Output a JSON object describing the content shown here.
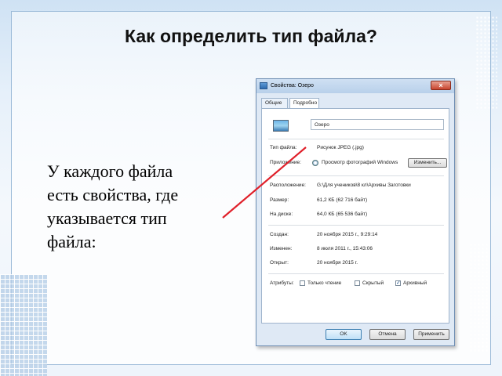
{
  "slide": {
    "title": "Как определить тип файла?",
    "body_lines": [
      "У каждого файла",
      "есть свойства, где",
      "указывается тип",
      "файла:"
    ]
  },
  "dialog": {
    "title": "Свойства: Озеро",
    "close_symbol": "×",
    "tabs": [
      {
        "label": "Общие",
        "active": true
      },
      {
        "label": "Подробно",
        "active": false
      }
    ],
    "file_name": "Озеро",
    "rows": [
      {
        "label": "Тип файла:",
        "value": "Рисунок JPEG (.jpg)"
      },
      {
        "label": "Приложение:",
        "value": "Просмотр фотографий Windows"
      },
      {
        "label": "Расположение:",
        "value": "G:\\Для учеников\\8 кл\\Архивы Заготовки"
      },
      {
        "label": "Размер:",
        "value": "61,2 КБ (62 716 байт)"
      },
      {
        "label": "На диске:",
        "value": "64,0 КБ (65 536 байт)"
      },
      {
        "label": "Создан:",
        "value": "20 ноября 2015 г., 9:29:14"
      },
      {
        "label": "Изменен:",
        "value": "8 июля 2011 г., 15:43:06"
      },
      {
        "label": "Открыт:",
        "value": "20 ноября 2015 г."
      }
    ],
    "change_button": "Изменить...",
    "attributes_label": "Атрибуты:",
    "attributes": [
      {
        "label": "Только чтение",
        "checked": false
      },
      {
        "label": "Скрытый",
        "checked": false
      },
      {
        "label": "Архивный",
        "checked": true
      }
    ],
    "buttons": {
      "ok": "OK",
      "cancel": "Отмена",
      "apply": "Применить"
    }
  },
  "colors": {
    "pointer_line": "#e0202a",
    "accent": "#3c7fb1"
  },
  "icons": {
    "file": "image-file-icon",
    "app": "photo-viewer-icon",
    "close": "close-icon"
  }
}
